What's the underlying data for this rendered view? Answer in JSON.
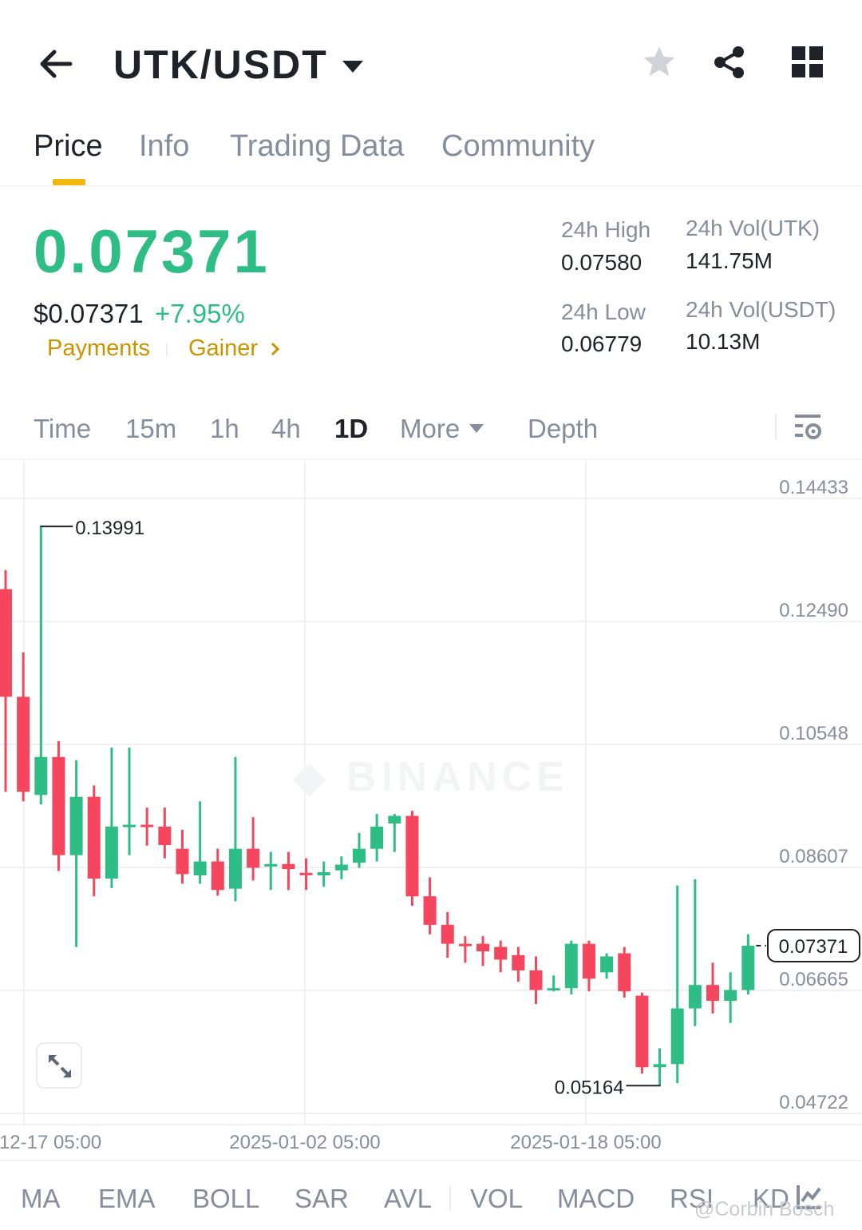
{
  "header": {
    "pair": "UTK/USDT",
    "icons": [
      "back-arrow-icon",
      "star-icon",
      "share-icon",
      "grid-icon"
    ]
  },
  "tabs": [
    "Price",
    "Info",
    "Trading Data",
    "Community"
  ],
  "active_tab": "Price",
  "ticker": {
    "last_price": "0.07371",
    "usd_price": "$0.07371",
    "change": "+7.95%",
    "tags": [
      "Payments",
      "Gainer"
    ],
    "stats": {
      "high_label": "24h High",
      "high_value": "0.07580",
      "low_label": "24h Low",
      "low_value": "0.06779",
      "vol_base_label": "24h Vol(UTK)",
      "vol_base_value": "141.75M",
      "vol_quote_label": "24h Vol(USDT)",
      "vol_quote_value": "10.13M"
    }
  },
  "timeframes": [
    "Time",
    "15m",
    "1h",
    "4h",
    "1D",
    "More",
    "Depth"
  ],
  "active_timeframe": "1D",
  "indicators": [
    "MA",
    "EMA",
    "BOLL",
    "SAR",
    "AVL",
    "VOL",
    "MACD",
    "RSI",
    "KD"
  ],
  "watermark": "@Corbin Bosch",
  "colors": {
    "up": "#2ebd85",
    "down": "#f6465d",
    "accent": "#f0b90b",
    "muted": "#848e9c"
  },
  "chart_data": {
    "type": "candlestick",
    "interval": "1D",
    "y_ticks": [
      "0.14433",
      "0.12490",
      "0.10548",
      "0.08607",
      "0.06665",
      "0.04722"
    ],
    "x_ticks": [
      "12-17 05:00",
      "2025-01-02 05:00",
      "2025-01-18 05:00"
    ],
    "ylim": [
      0.0472,
      0.1443
    ],
    "current_price": "0.07371",
    "high_marker": "0.13991",
    "low_marker": "0.05164",
    "watermark_logo": "BINANCE",
    "candles": [
      {
        "o": 0.13,
        "h": 0.133,
        "l": 0.098,
        "c": 0.113
      },
      {
        "o": 0.113,
        "h": 0.12,
        "l": 0.0965,
        "c": 0.098
      },
      {
        "o": 0.0975,
        "h": 0.1399,
        "l": 0.096,
        "c": 0.1035
      },
      {
        "o": 0.1035,
        "h": 0.106,
        "l": 0.0855,
        "c": 0.088
      },
      {
        "o": 0.088,
        "h": 0.103,
        "l": 0.0735,
        "c": 0.0972
      },
      {
        "o": 0.0972,
        "h": 0.099,
        "l": 0.0815,
        "c": 0.0843
      },
      {
        "o": 0.0843,
        "h": 0.105,
        "l": 0.0828,
        "c": 0.0925
      },
      {
        "o": 0.0925,
        "h": 0.105,
        "l": 0.088,
        "c": 0.0928
      },
      {
        "o": 0.0928,
        "h": 0.0955,
        "l": 0.0895,
        "c": 0.0925
      },
      {
        "o": 0.0925,
        "h": 0.0955,
        "l": 0.0875,
        "c": 0.0896
      },
      {
        "o": 0.089,
        "h": 0.092,
        "l": 0.0835,
        "c": 0.085
      },
      {
        "o": 0.0848,
        "h": 0.0965,
        "l": 0.0835,
        "c": 0.087
      },
      {
        "o": 0.087,
        "h": 0.089,
        "l": 0.0816,
        "c": 0.0825
      },
      {
        "o": 0.0827,
        "h": 0.1035,
        "l": 0.0807,
        "c": 0.089
      },
      {
        "o": 0.089,
        "h": 0.094,
        "l": 0.084,
        "c": 0.086
      },
      {
        "o": 0.0862,
        "h": 0.0885,
        "l": 0.0825,
        "c": 0.0866
      },
      {
        "o": 0.0866,
        "h": 0.0885,
        "l": 0.0825,
        "c": 0.0858
      },
      {
        "o": 0.0852,
        "h": 0.0875,
        "l": 0.0825,
        "c": 0.085
      },
      {
        "o": 0.0848,
        "h": 0.087,
        "l": 0.083,
        "c": 0.0853
      },
      {
        "o": 0.0856,
        "h": 0.0878,
        "l": 0.0842,
        "c": 0.0865
      },
      {
        "o": 0.0868,
        "h": 0.0915,
        "l": 0.086,
        "c": 0.089
      },
      {
        "o": 0.089,
        "h": 0.0945,
        "l": 0.087,
        "c": 0.0925
      },
      {
        "o": 0.093,
        "h": 0.0945,
        "l": 0.0885,
        "c": 0.0942
      },
      {
        "o": 0.0942,
        "h": 0.095,
        "l": 0.08,
        "c": 0.0815
      },
      {
        "o": 0.0815,
        "h": 0.0845,
        "l": 0.0755,
        "c": 0.077
      },
      {
        "o": 0.077,
        "h": 0.079,
        "l": 0.0718,
        "c": 0.074
      },
      {
        "o": 0.074,
        "h": 0.0752,
        "l": 0.071,
        "c": 0.0738
      },
      {
        "o": 0.074,
        "h": 0.0752,
        "l": 0.0705,
        "c": 0.0728
      },
      {
        "o": 0.0735,
        "h": 0.0745,
        "l": 0.0695,
        "c": 0.0715
      },
      {
        "o": 0.0722,
        "h": 0.0735,
        "l": 0.068,
        "c": 0.0698
      },
      {
        "o": 0.0698,
        "h": 0.072,
        "l": 0.0645,
        "c": 0.0667
      },
      {
        "o": 0.0668,
        "h": 0.069,
        "l": 0.0665,
        "c": 0.067
      },
      {
        "o": 0.067,
        "h": 0.0745,
        "l": 0.066,
        "c": 0.074
      },
      {
        "o": 0.074,
        "h": 0.0745,
        "l": 0.0665,
        "c": 0.0685
      },
      {
        "o": 0.0695,
        "h": 0.0725,
        "l": 0.0685,
        "c": 0.072
      },
      {
        "o": 0.0725,
        "h": 0.0735,
        "l": 0.0655,
        "c": 0.0665
      },
      {
        "o": 0.0658,
        "h": 0.0663,
        "l": 0.0535,
        "c": 0.0545
      },
      {
        "o": 0.0545,
        "h": 0.0575,
        "l": 0.0516,
        "c": 0.055
      },
      {
        "o": 0.055,
        "h": 0.0832,
        "l": 0.052,
        "c": 0.0638
      },
      {
        "o": 0.0638,
        "h": 0.0842,
        "l": 0.061,
        "c": 0.0675
      },
      {
        "o": 0.0675,
        "h": 0.071,
        "l": 0.063,
        "c": 0.065
      },
      {
        "o": 0.065,
        "h": 0.0695,
        "l": 0.0615,
        "c": 0.0667
      },
      {
        "o": 0.0667,
        "h": 0.0755,
        "l": 0.066,
        "c": 0.0737
      }
    ]
  }
}
